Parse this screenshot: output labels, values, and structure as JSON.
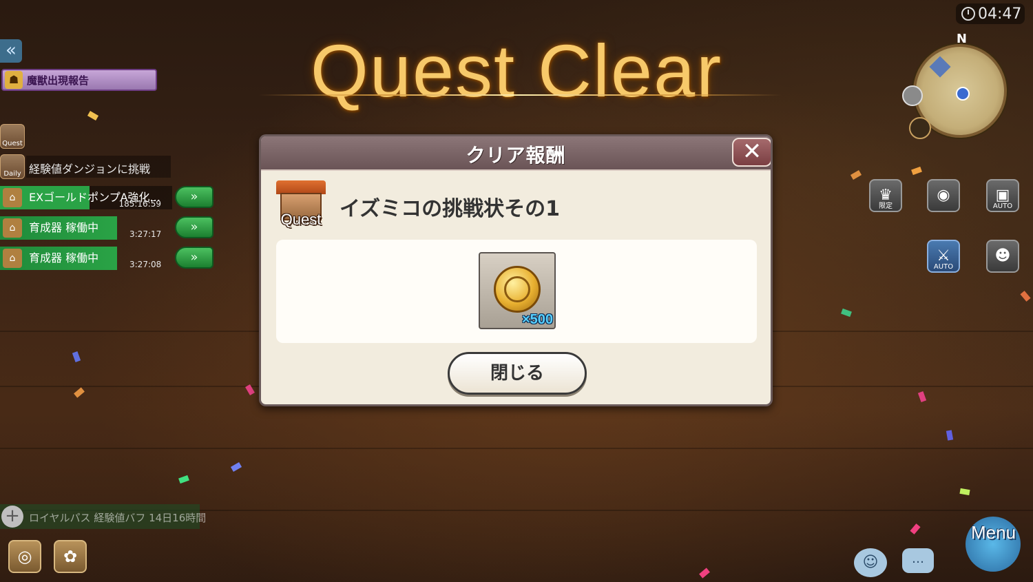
{
  "header": {
    "clock": "04:47",
    "title": "Quest Clear",
    "compass": "N"
  },
  "left_panel": {
    "back_icon": "double-chevron-left-icon",
    "alert": {
      "label": "魔獣出現報告",
      "icon": "beast-mask-icon"
    },
    "quest_icon_label": "Quest",
    "daily": {
      "icon_label": "Daily",
      "text": "経験値ダンジョンに挑戦"
    },
    "tasks": [
      {
        "label": "EXゴールドポンプA強化...",
        "time": "185:16:59"
      },
      {
        "label": "育成器 稼働中",
        "time": "3:27:17"
      },
      {
        "label": "育成器 稼働中",
        "time": "3:27:08"
      }
    ],
    "buff": {
      "text": "ロイヤルパス 経験値バフ 14日16時間"
    }
  },
  "right_panel": {
    "buttons": [
      {
        "name": "limited-button",
        "sub": "限定",
        "icon": "hat-icon"
      },
      {
        "name": "camera-button",
        "sub": "",
        "icon": "camera-icon"
      },
      {
        "name": "auto-camera-button",
        "sub": "AUTO",
        "icon": "frame-icon"
      },
      {
        "name": "auto-battle-button",
        "sub": "AUTO",
        "icon": "sword-icon"
      },
      {
        "name": "party-button",
        "sub": "",
        "icon": "group-icon"
      }
    ],
    "menu_label": "Menu"
  },
  "dialog": {
    "title": "クリア報酬",
    "close_icon": "close-x-icon",
    "quest_icon_label": "Quest",
    "quest_name": "イズミコの挑戦状その1",
    "reward": {
      "icon": "gold-coin-icon",
      "quantity": "×500"
    },
    "close_button": "閉じる"
  },
  "colors": {
    "title_gold": "#f7c96a",
    "task_green": "#2aa346",
    "dialog_header": "#7a6466",
    "dialog_bg": "#f2ecde",
    "quantity_blue": "#58d0ff"
  }
}
